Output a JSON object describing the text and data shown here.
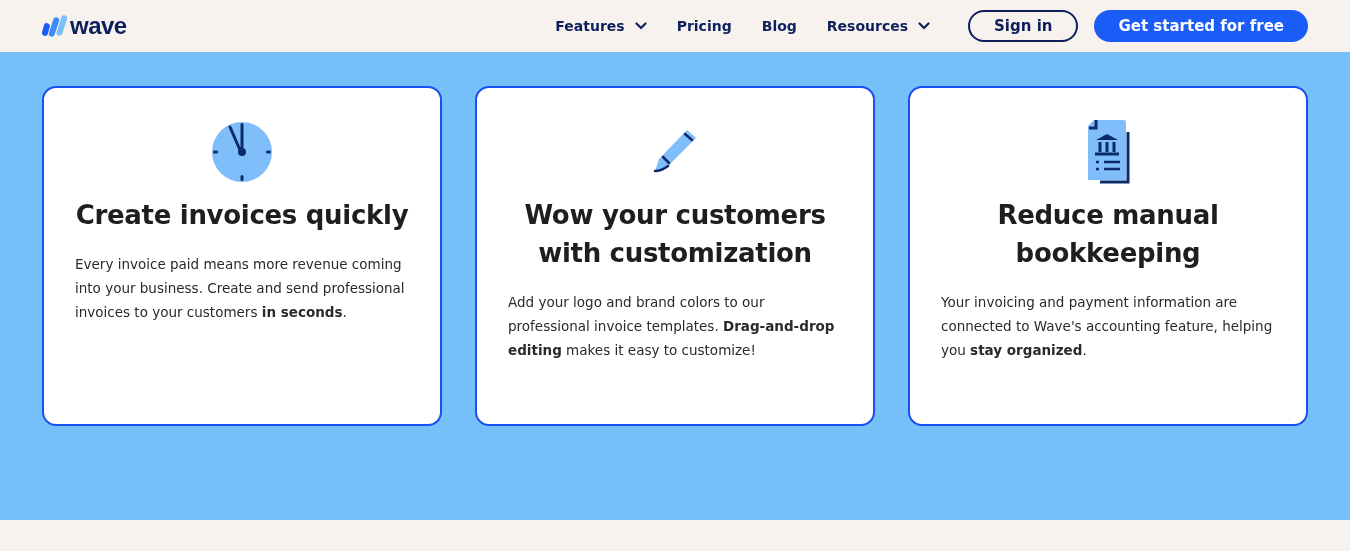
{
  "header": {
    "logo": "wave",
    "nav": [
      {
        "label": "Features",
        "dropdown": true
      },
      {
        "label": "Pricing",
        "dropdown": false
      },
      {
        "label": "Blog",
        "dropdown": false
      },
      {
        "label": "Resources",
        "dropdown": true
      }
    ],
    "sign_in": "Sign in",
    "cta": "Get started for free"
  },
  "cards": [
    {
      "kind": "clock",
      "title": "Create invoices quickly",
      "body": "Every invoice paid means more revenue coming into your business. Create and send professional invoices to your customers **in seconds**."
    },
    {
      "kind": "pencil",
      "title": "Wow your customers with customization",
      "body": "Add your logo and brand colors to our professional invoice templates. **Drag-and-drop editing** makes it easy to customize!"
    },
    {
      "kind": "document",
      "title": "Reduce manual bookkeeping",
      "body": "Your invoicing and payment information are connected to Wave's accounting feature, helping you **stay organized**."
    }
  ]
}
